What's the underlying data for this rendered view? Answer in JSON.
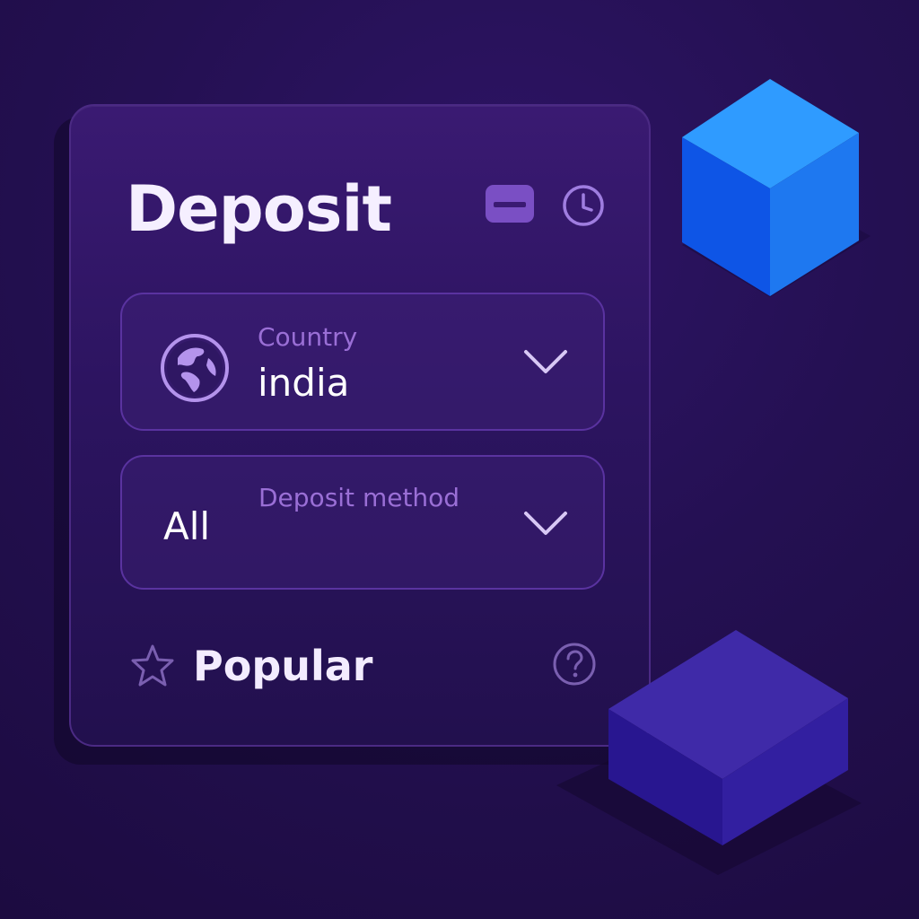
{
  "panel": {
    "title": "Deposit"
  },
  "header_icons": [
    "card-icon",
    "clock-icon"
  ],
  "country_select": {
    "label": "Country",
    "value": "india",
    "icon": "globe-icon"
  },
  "method_select": {
    "label": "Deposit method",
    "value": "All"
  },
  "popular": {
    "label": "Popular",
    "icon": "star-icon",
    "help_icon": "question-circle-icon"
  },
  "colors": {
    "background": "#241052",
    "panel": "#2c1460",
    "field_border": "#5a33a0",
    "label": "#9a6fd6",
    "cube_blue": "#1a7cf2",
    "cube_purple": "#3a26a8"
  }
}
